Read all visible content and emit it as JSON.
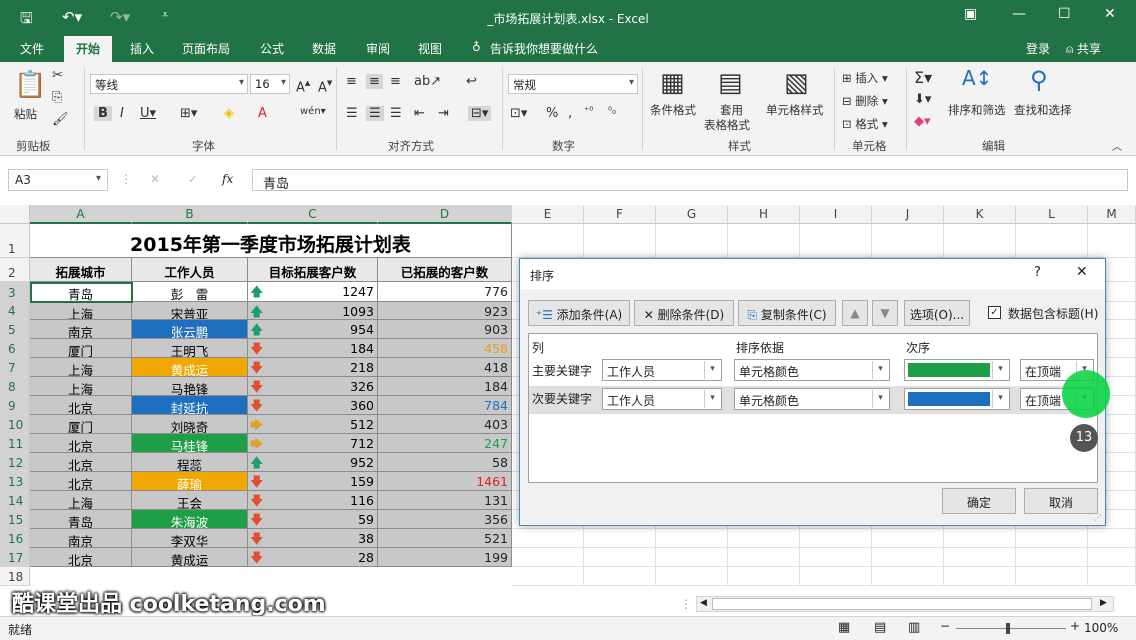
{
  "app": {
    "title": "_市场拓展计划表.xlsx - Excel"
  },
  "menu": {
    "file": "文件",
    "home": "开始",
    "insert": "插入",
    "layout": "页面布局",
    "formulas": "公式",
    "data": "数据",
    "review": "审阅",
    "view": "视图",
    "tellme": "告诉我你想要做什么",
    "login": "登录",
    "share": "共享"
  },
  "ribbon": {
    "paste": "粘贴",
    "clipboard": "剪贴板",
    "font_name": "等线",
    "font_size": "16",
    "font": "字体",
    "align": "对齐方式",
    "number_format": "常规",
    "number": "数字",
    "cond_format": "条件格式",
    "table_format_1": "套用",
    "table_format_2": "表格格式",
    "cell_style": "单元格样式",
    "styles": "样式",
    "insert": "插入",
    "delete": "删除",
    "format": "格式",
    "cells": "单元格",
    "sort_filter": "排序和筛选",
    "find_select": "查找和选择",
    "editing": "编辑"
  },
  "formula_bar": {
    "name_box": "A3",
    "value": "青岛"
  },
  "columns": [
    "A",
    "B",
    "C",
    "D",
    "E",
    "F",
    "G",
    "H",
    "I",
    "J",
    "K",
    "L",
    "M"
  ],
  "sheet": {
    "title": "2015年第一季度市场拓展计划表",
    "headers": [
      "拓展城市",
      "工作人员",
      "目标拓展客户数",
      "已拓展的客户数"
    ],
    "rows": [
      {
        "n": "3",
        "city": "青岛",
        "person": "彭　雷",
        "pfill": "",
        "target": "1247",
        "done": "776",
        "dcolor": "#222",
        "arrow": "up"
      },
      {
        "n": "4",
        "city": "上海",
        "person": "宋普亚",
        "pfill": "",
        "target": "1093",
        "done": "923",
        "dcolor": "#222",
        "arrow": "up"
      },
      {
        "n": "5",
        "city": "南京",
        "person": "张云鹏",
        "pfill": "#1f6fbf",
        "target": "954",
        "done": "903",
        "dcolor": "#222",
        "arrow": "up"
      },
      {
        "n": "6",
        "city": "厦门",
        "person": "王明飞",
        "pfill": "",
        "target": "184",
        "done": "458",
        "dcolor": "#e8a020",
        "arrow": "down"
      },
      {
        "n": "7",
        "city": "上海",
        "person": "黄成运",
        "pfill": "#f0a800",
        "target": "218",
        "done": "418",
        "dcolor": "#222",
        "arrow": "down"
      },
      {
        "n": "8",
        "city": "上海",
        "person": "马艳锋",
        "pfill": "",
        "target": "326",
        "done": "184",
        "dcolor": "#222",
        "arrow": "down"
      },
      {
        "n": "9",
        "city": "北京",
        "person": "封延抗",
        "pfill": "#1f6fbf",
        "target": "360",
        "done": "784",
        "dcolor": "#1f6fbf",
        "arrow": "down"
      },
      {
        "n": "10",
        "city": "厦门",
        "person": "刘晓奇",
        "pfill": "",
        "target": "512",
        "done": "403",
        "dcolor": "#222",
        "arrow": "right"
      },
      {
        "n": "11",
        "city": "北京",
        "person": "马桂锋",
        "pfill": "#1e9e46",
        "target": "712",
        "done": "247",
        "dcolor": "#1e9e46",
        "arrow": "right"
      },
      {
        "n": "12",
        "city": "北京",
        "person": "程蕊",
        "pfill": "",
        "target": "952",
        "done": "58",
        "dcolor": "#222",
        "arrow": "up"
      },
      {
        "n": "13",
        "city": "北京",
        "person": "薛瑜",
        "pfill": "#f0a800",
        "target": "159",
        "done": "1461",
        "dcolor": "#e02020",
        "arrow": "down"
      },
      {
        "n": "14",
        "city": "上海",
        "person": "王会",
        "pfill": "",
        "target": "116",
        "done": "131",
        "dcolor": "#222",
        "arrow": "down"
      },
      {
        "n": "15",
        "city": "青岛",
        "person": "朱海波",
        "pfill": "#1e9e46",
        "target": "59",
        "done": "356",
        "dcolor": "#222",
        "arrow": "down"
      },
      {
        "n": "16",
        "city": "南京",
        "person": "李双华",
        "pfill": "",
        "target": "38",
        "done": "521",
        "dcolor": "#222",
        "arrow": "down"
      },
      {
        "n": "17",
        "city": "北京",
        "person": "黄成运",
        "pfill": "",
        "target": "28",
        "done": "199",
        "dcolor": "#222",
        "arrow": "down"
      }
    ]
  },
  "dialog": {
    "title": "排序",
    "help": "?",
    "close": "✕",
    "add": "添加条件(A)",
    "delete": "删除条件(D)",
    "copy": "复制条件(C)",
    "options": "选项(O)...",
    "has_header": "数据包含标题(H)",
    "col_header": "列",
    "sort_on_header": "排序依据",
    "order_header": "次序",
    "primary_label": "主要关键字",
    "primary_col": "工作人员",
    "primary_sort_on": "单元格颜色",
    "primary_color": "#1e9e46",
    "primary_pos": "在顶端",
    "secondary_label": "次要关键字",
    "secondary_col": "工作人员",
    "secondary_sort_on": "单元格颜色",
    "secondary_color": "#1f6fbf",
    "secondary_pos": "在顶端",
    "ok": "确定",
    "cancel": "取消"
  },
  "overlay": {
    "step": "13",
    "watermark": "酷课堂出品 coolketang.com"
  },
  "status": {
    "ready": "就绪",
    "zoom": "100%"
  }
}
